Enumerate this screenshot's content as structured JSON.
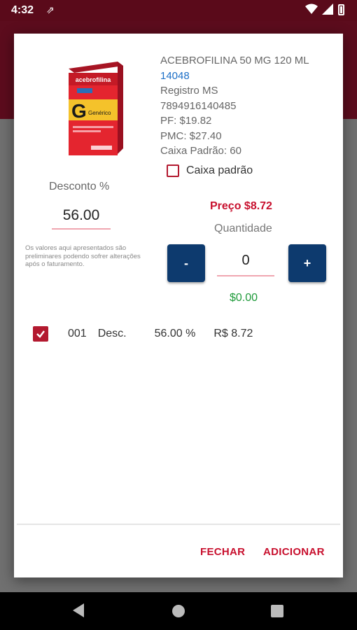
{
  "status": {
    "time": "4:32"
  },
  "product": {
    "name": "ACEBROFILINA 50 MG 120 ML",
    "code": "14048",
    "registro_label": "Registro MS",
    "registro": "7894916140485",
    "pf": "PF: $19.82",
    "pmc": "PMC: $27.40",
    "caixa": "Caixa Padrão: 60",
    "box_brand": "acebrofilina",
    "box_letter": "G",
    "box_generic": "Genérico"
  },
  "caixa_padrao": {
    "label": "Caixa padrão",
    "checked": false
  },
  "desconto": {
    "label": "Desconto %",
    "value": "56.00"
  },
  "disclaimer": "Os valores aqui apresentados são preliminares podendo sofrer alterações após o faturamento.",
  "price": "Preço $8.72",
  "quantidade": {
    "label": "Quantidade",
    "minus": "-",
    "plus": "+",
    "value": "0"
  },
  "total": "$0.00",
  "item": {
    "num": "001",
    "desc": "Desc.",
    "pct": "56.00 %",
    "value": "R$ 8.72",
    "checked": true
  },
  "actions": {
    "fechar": "FECHAR",
    "adicionar": "ADICIONAR"
  },
  "colors": {
    "accent": "#c8102e",
    "primary_button": "#0d3a6e",
    "total_green": "#1f9a3a",
    "link_blue": "#1c6fc7"
  }
}
